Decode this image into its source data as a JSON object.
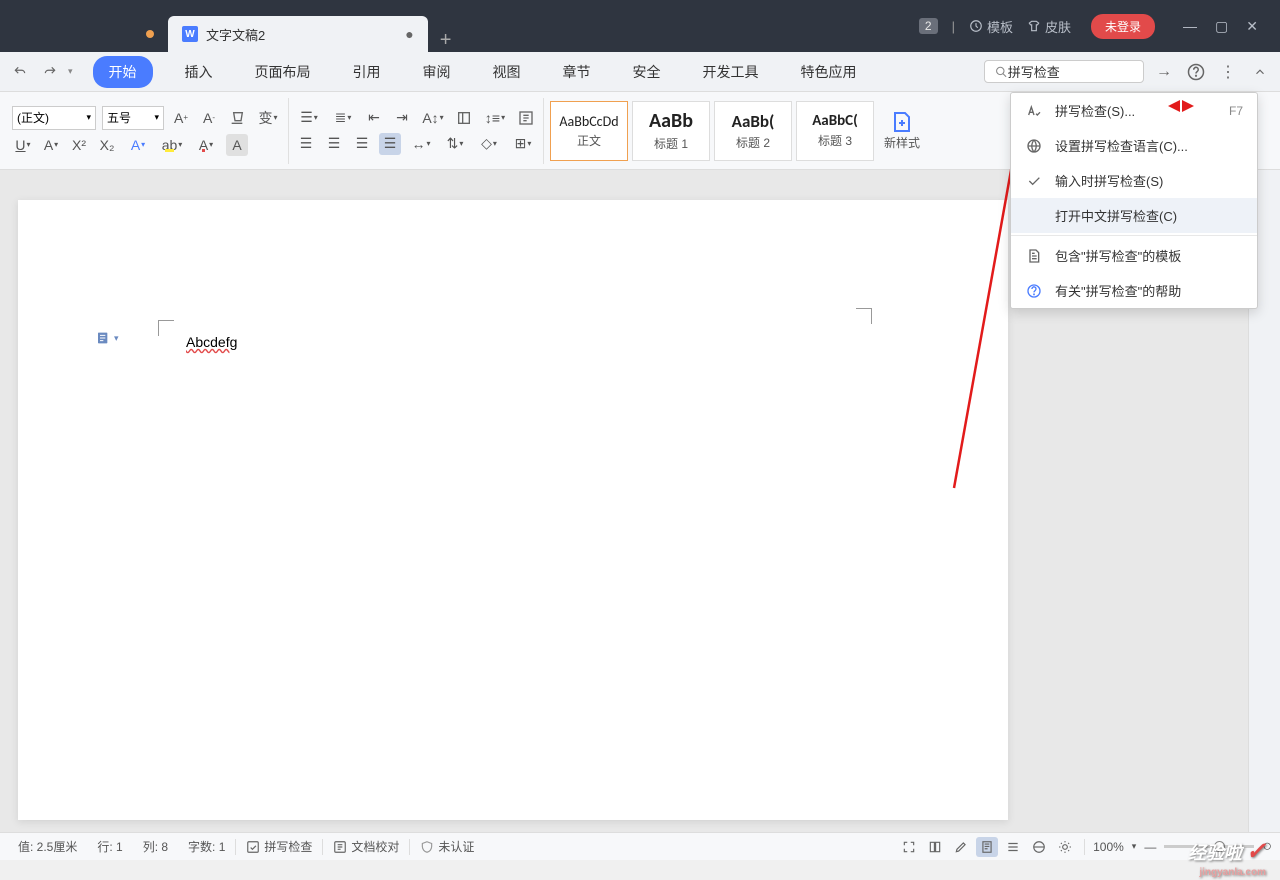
{
  "titlebar": {
    "tab1_dot": true,
    "tab2_label": "文字文稿2",
    "badge": "2",
    "template": "模板",
    "skin": "皮肤",
    "login": "未登录"
  },
  "menu": {
    "tabs": [
      "开始",
      "插入",
      "页面布局",
      "引用",
      "审阅",
      "视图",
      "章节",
      "安全",
      "开发工具",
      "特色应用"
    ],
    "active_index": 0
  },
  "search": {
    "value": "拼写检查"
  },
  "ribbon": {
    "font_name": "(正文)",
    "font_size": "五号",
    "styles": [
      {
        "preview": "AaBbCcDd",
        "label": "正文",
        "cls": ""
      },
      {
        "preview": "AaBb",
        "label": "标题 1",
        "cls": "big"
      },
      {
        "preview": "AaBb(",
        "label": "标题 2",
        "cls": "med"
      },
      {
        "preview": "AaBbC(",
        "label": "标题 3",
        "cls": "sm"
      }
    ],
    "new_style": "新样式"
  },
  "dropdown": {
    "items": [
      {
        "icon": "spell",
        "label": "拼写检查(S)...",
        "shortcut": "F7"
      },
      {
        "icon": "globe",
        "label": "设置拼写检查语言(C)..."
      },
      {
        "icon": "check",
        "label": "输入时拼写检查(S)"
      },
      {
        "icon": "",
        "label": "打开中文拼写检查(C)",
        "hover": true
      },
      {
        "sep": true
      },
      {
        "icon": "doc",
        "label": "包含\"拼写检查\"的模板"
      },
      {
        "icon": "help",
        "label": "有关\"拼写检查\"的帮助"
      }
    ]
  },
  "document": {
    "text": "Abcdefg"
  },
  "status": {
    "pos": "值: 2.5厘米",
    "row": "行: 1",
    "col": "列: 8",
    "chars": "字数: 1",
    "spellcheck": "拼写检查",
    "proofing": "文档校对",
    "cert": "未认证",
    "zoom": "100%"
  },
  "watermark": {
    "text": "经验啦",
    "sub": "jingyanla.com"
  }
}
